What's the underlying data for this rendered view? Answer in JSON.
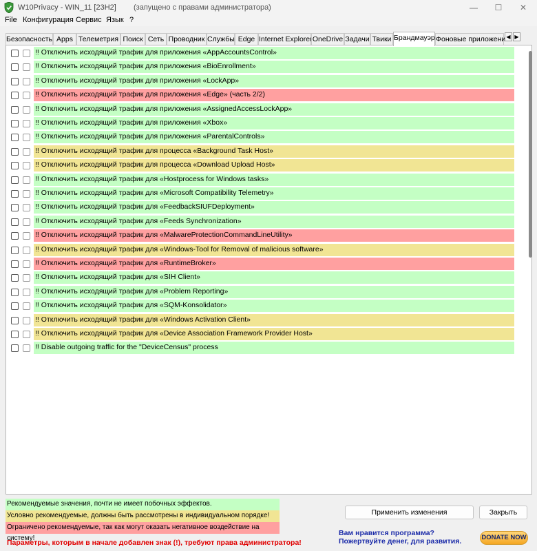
{
  "window": {
    "title": "W10Privacy - WIN_11 [23H2]",
    "admin_note": "(запущено с правами администратора)",
    "controls": {
      "minimize": "—",
      "maximize": "☐",
      "close": "✕"
    }
  },
  "menu": [
    "File",
    "Конфигурация",
    "Сервис",
    "Язык",
    "?"
  ],
  "tabs": [
    "Безопасность",
    "Apps",
    "Телеметрия",
    "Поиск",
    "Сеть",
    "Проводник",
    "Службы",
    "Edge",
    "Internet Explorer",
    "OneDrive",
    "Задачи",
    "Твики",
    "Брандмауэр",
    "Фоновые приложения"
  ],
  "active_tab": "Брандмауэр",
  "tab_scroll": {
    "left": "◀",
    "right": "▶"
  },
  "rows": [
    {
      "label": "!! Отключить исходящий трафик для приложения «AppAccountsControl»",
      "level": "green"
    },
    {
      "label": "!! Отключить исходящий трафик для приложения «BioEnrollment»",
      "level": "green"
    },
    {
      "label": "!! Отключить исходящий трафик для приложения «LockApp»",
      "level": "green"
    },
    {
      "label": "!! Отключить исходящий трафик для приложения «Edge» (часть 2/2)",
      "level": "red"
    },
    {
      "label": "!! Отключить исходящий трафик для приложения «AssignedAccessLockApp»",
      "level": "green"
    },
    {
      "label": "!! Отключить исходящий трафик для приложения «Xbox»",
      "level": "green"
    },
    {
      "label": "!! Отключить исходящий трафик для приложения «ParentalControls»",
      "level": "green"
    },
    {
      "label": "!! Отключить исходящий трафик для процесса «Background Task Host»",
      "level": "yellow"
    },
    {
      "label": "!! Отключить исходящий трафик для процесса «Download Upload Host»",
      "level": "yellow"
    },
    {
      "label": "!! Отключить исходящий трафик для «Hostprocess for Windows tasks»",
      "level": "green"
    },
    {
      "label": "!! Отключить исходящий трафик для «Microsoft Compatibility Telemetry»",
      "level": "green"
    },
    {
      "label": "!! Отключить исходящий трафик для «FeedbackSIUFDeployment»",
      "level": "green"
    },
    {
      "label": "!! Отключить исходящий трафик для «Feeds Synchronization»",
      "level": "green"
    },
    {
      "label": "!! Отключить исходящий трафик для «MalwareProtectionCommandLineUtility»",
      "level": "red"
    },
    {
      "label": "!! Отключить исходящий трафик для «Windows-Tool for Removal of malicious software»",
      "level": "yellow"
    },
    {
      "label": "!! Отключить исходящий трафик для «RuntimeBroker»",
      "level": "red"
    },
    {
      "label": "!! Отключить исходящий трафик для «SIH Client»",
      "level": "green"
    },
    {
      "label": "!! Отключить исходящий трафик для «Problem Reporting»",
      "level": "green"
    },
    {
      "label": "!! Отключить исходящий трафик для «SQM-Konsolidator»",
      "level": "green"
    },
    {
      "label": "!! Отключить исходящий трафик для «Windows Activation Client»",
      "level": "yellow"
    },
    {
      "label": "!! Отключить исходящий трафик для «Device Association Framework Provider Host»",
      "level": "yellow"
    },
    {
      "label": "!! Disable outgoing traffic for the \"DeviceCensus\" process",
      "level": "green"
    }
  ],
  "legend": {
    "green": "Рекомендуемые значения, почти не имеет побочных эффектов.",
    "yellow": "Условно рекомендуемые, должны быть рассмотрены в индивидуальном порядке!",
    "red": "Ограничено рекомендуемые, так как могут оказать негативное воздействие на систему!"
  },
  "admin_params_note": "Параметры, которым в начале добавлен знак (!), требуют права администратора!",
  "buttons": {
    "apply": "Применить изменения",
    "exit": "Закрыть"
  },
  "donate": {
    "line1": "Вам нравится программа?",
    "line2": "Пожертвуйте денег, для развития.",
    "button": "DONATE NOW"
  },
  "colors": {
    "green": "#c4ffc4",
    "yellow": "#f1e594",
    "red": "#ffa0a0",
    "warning_text": "#e00000",
    "donate_text": "#1a2aa8"
  }
}
